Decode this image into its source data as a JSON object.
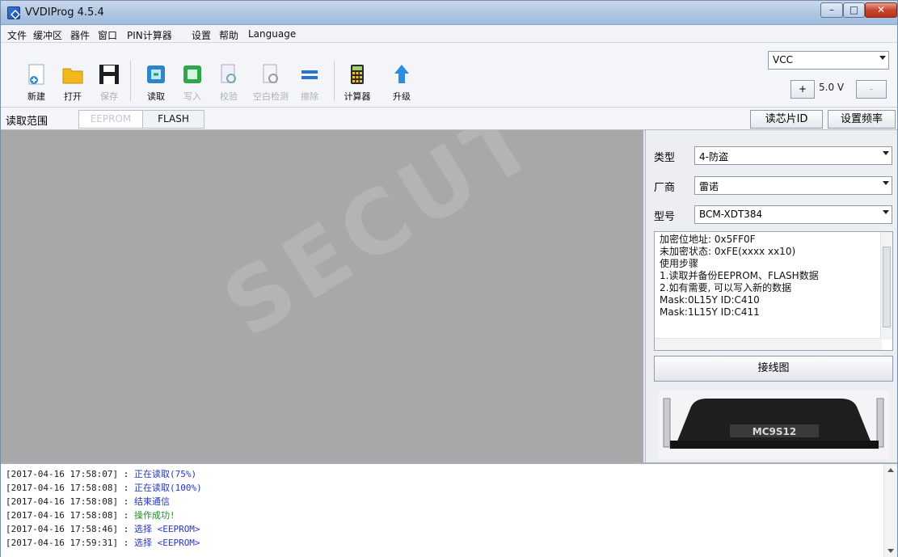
{
  "window": {
    "title": "VVDIProg 4.5.4"
  },
  "menu": [
    "文件",
    "缓冲区",
    "器件",
    "窗口",
    "PIN计算器",
    "设置",
    "帮助",
    "Language"
  ],
  "toolbar": {
    "new": "新建",
    "open": "打开",
    "save": "保存",
    "read": "读取",
    "write": "写入",
    "verify": "校验",
    "blank_check": "空白检测",
    "erase": "擦除",
    "calculator": "计算器",
    "upgrade": "升级"
  },
  "power": {
    "source": "VCC",
    "increase": "+",
    "voltage": "5.0 V",
    "decrease": "-"
  },
  "range": {
    "label": "读取范围",
    "tabs": [
      "EEPROM",
      "FLASH"
    ],
    "read_chip_id": "读芯片ID",
    "set_frequency": "设置频率"
  },
  "device": {
    "type_label": "类型",
    "type_value": "4-防盗",
    "vendor_label": "厂商",
    "vendor_value": "雷诺",
    "model_label": "型号",
    "model_value": "BCM-XDT384",
    "info": [
      "加密位地址: 0x5FF0F",
      "未加密状态: 0xFE(xxxx xx10)",
      "使用步骤",
      "1.读取并备份EEPROM、FLASH数据",
      "2.如有需要, 可以写入新的数据",
      "Mask:0L15Y ID:C410",
      "Mask:1L15Y ID:C411"
    ],
    "wiring_button": "接线图",
    "chip_label": "MC9S12"
  },
  "watermark": "SECUT",
  "log": [
    {
      "time": "[2017-04-16 17:58:07]",
      "sep": " : ",
      "msg": "正在读取(75%)",
      "ok": false
    },
    {
      "time": "[2017-04-16 17:58:08]",
      "sep": " : ",
      "msg": "正在读取(100%)",
      "ok": false
    },
    {
      "time": "[2017-04-16 17:58:08]",
      "sep": " : ",
      "msg": "结束通信",
      "ok": false
    },
    {
      "time": "[2017-04-16 17:58:08]",
      "sep": " : ",
      "msg": "操作成功!",
      "ok": true
    },
    {
      "time": "[2017-04-16 17:58:46]",
      "sep": " : ",
      "msg": "选择 <EEPROM>",
      "ok": false
    },
    {
      "time": "[2017-04-16 17:59:31]",
      "sep": " : ",
      "msg": "选择 <EEPROM>",
      "ok": false
    }
  ],
  "colors": {
    "log_info": "#2436c8",
    "log_success": "#1f8f23",
    "canvas_bg": "#a8a8a8"
  },
  "icons": [
    "new-file-icon",
    "open-folder-icon",
    "save-disk-icon",
    "read-chip-icon",
    "write-chip-icon",
    "verify-icon",
    "blank-check-icon",
    "erase-icon",
    "calculator-icon",
    "upgrade-arrow-icon"
  ]
}
